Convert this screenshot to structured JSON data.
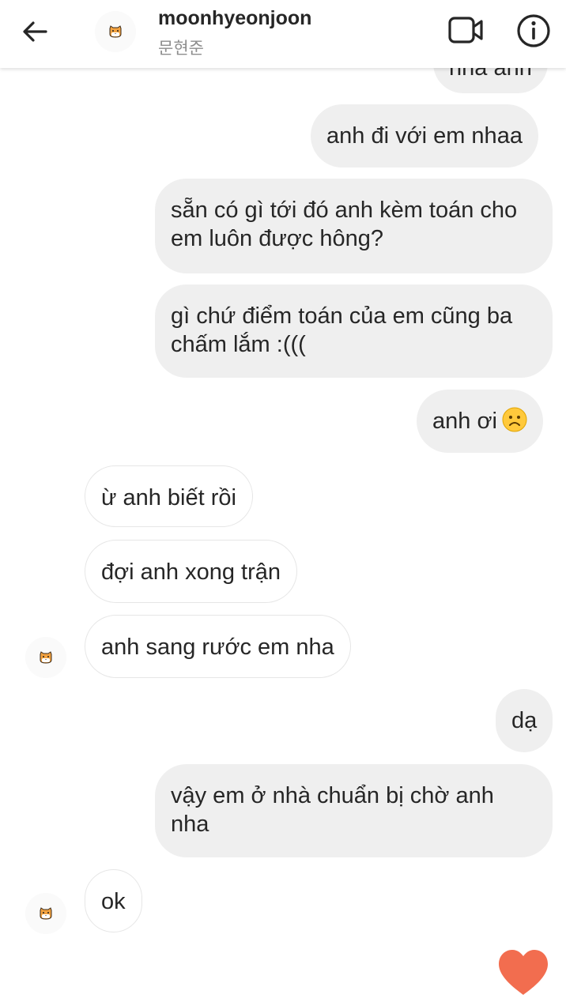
{
  "header": {
    "username": "moonhyeonjoon",
    "subtitle": "문현준"
  },
  "messages": [
    {
      "from": "me",
      "text": "nha anh"
    },
    {
      "from": "me",
      "text": "anh đi với em nhaa"
    },
    {
      "from": "me",
      "text": "sẵn có gì tới đó anh kèm toán cho em luôn được hông?"
    },
    {
      "from": "me",
      "text": "gì chứ điểm toán của em cũng ba chấm lắm :((("
    },
    {
      "from": "me",
      "text": "anh ơi",
      "emoji": "frowning-face"
    },
    {
      "from": "them",
      "text": "ừ anh biết rồi"
    },
    {
      "from": "them",
      "text": "đợi anh xong trận"
    },
    {
      "from": "them",
      "text": "anh sang rước em nha"
    },
    {
      "from": "me",
      "text": "dạ"
    },
    {
      "from": "me",
      "text": "vậy em ở nhà chuẩn bị chờ anh nha"
    },
    {
      "from": "them",
      "text": "ok"
    }
  ],
  "colors": {
    "sent_bubble": "#efefef",
    "received_border": "#e6e6e6",
    "heart": "#f26d4f",
    "subtitle": "#8e8e8e"
  }
}
